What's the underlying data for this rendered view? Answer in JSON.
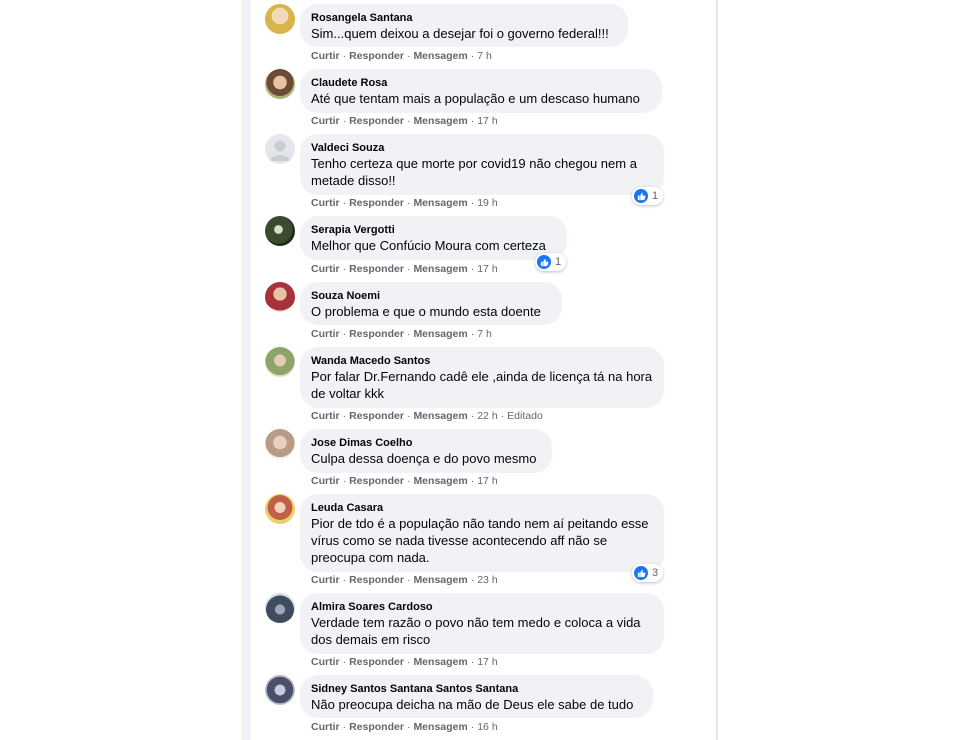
{
  "actions": {
    "like": "Curtir",
    "reply": "Responder",
    "message": "Mensagem",
    "dot": "·"
  },
  "colors": {
    "bubble": "#f0f2f5",
    "like_blue": "#1877f2",
    "meta_gray": "#65676b"
  },
  "comments": [
    {
      "author": "Rosangela Santana",
      "text": "Sim...quem deixou a desejar foi o governo federal!!!",
      "time": "7 h",
      "avatar_color": "#d9b44a"
    },
    {
      "author": "Claudete Rosa",
      "text": "Até que tentam mais a população e um descaso humano",
      "time": "17 h",
      "avatar_color": "#8a6a52"
    },
    {
      "author": "Valdeci Souza",
      "text": "Tenho certeza que morte por covid19 não chegou nem a metade disso!!",
      "time": "19 h",
      "avatar_color": "#c9ccd1",
      "reactions": "1"
    },
    {
      "author": "Serapia Vergotti",
      "text": "Melhor que Confúcio Moura com certeza",
      "time": "17 h",
      "avatar_color": "#3c4a2e",
      "reactions": "1"
    },
    {
      "author": "Souza Noemi",
      "text": "O problema e que o mundo esta doente",
      "time": "7 h",
      "avatar_color": "#a8323a"
    },
    {
      "author": "Wanda Macedo Santos",
      "text": "Por falar Dr.Fernando cadê ele ,ainda de licença tá na hora de voltar kkk",
      "time": "22 h",
      "edited": "Editado",
      "avatar_color": "#8fa46a"
    },
    {
      "author": "Jose Dimas Coelho",
      "text": "Culpa dessa doença e do povo mesmo",
      "time": "17 h",
      "avatar_color": "#b89a86"
    },
    {
      "author": "Leuda Casara",
      "text": "Pior de tdo é a população não tando nem aí peitando esse vírus como se nada tivesse acontecendo aff não se preocupa com nada.",
      "time": "23 h",
      "avatar_color": "#c0604a",
      "reactions": "3"
    },
    {
      "author": "Almira Soares Cardoso",
      "text": "Verdade tem razão o povo não tem medo e coloca a vida dos demais em risco",
      "time": "17 h",
      "avatar_color": "#3e4c5e"
    },
    {
      "author": "Sidney Santos Santana Santos Santana",
      "text": "Não preocupa deicha na mão de Deus ele sabe de tudo",
      "time": "16 h",
      "avatar_color": "#4a4f6a"
    }
  ]
}
